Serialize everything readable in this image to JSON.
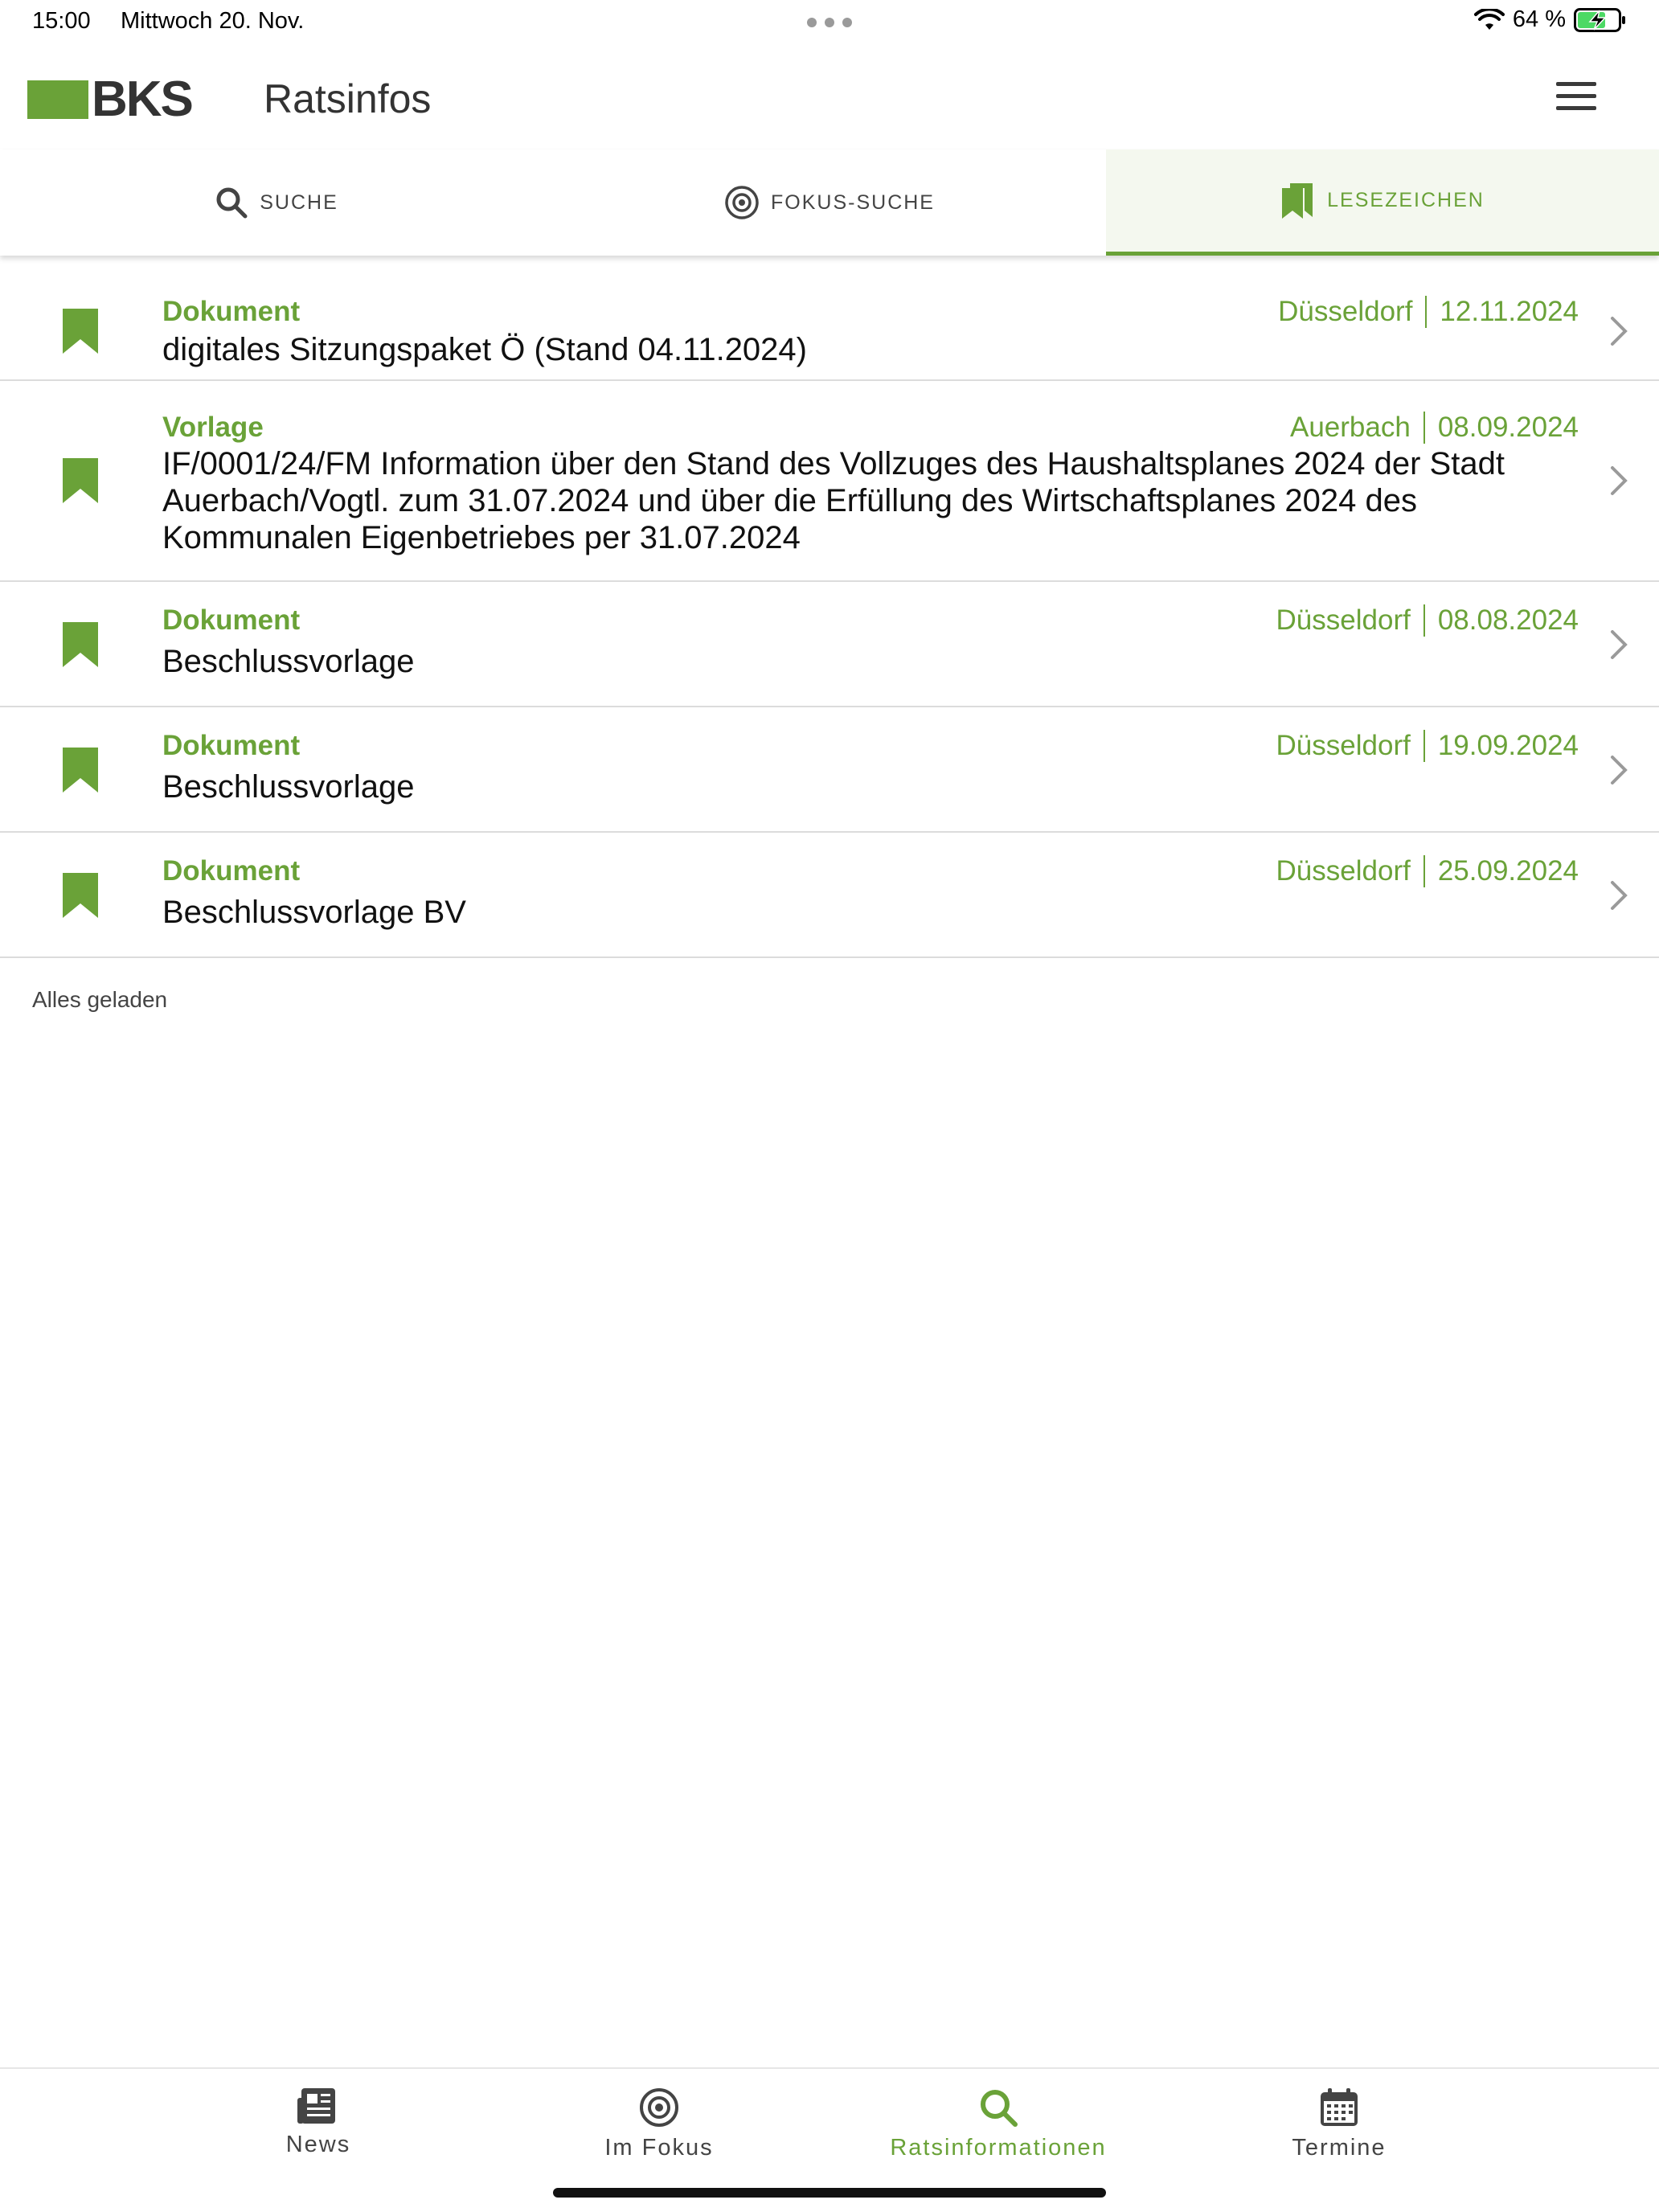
{
  "status": {
    "time": "15:00",
    "date": "Mittwoch 20. Nov.",
    "battery": "64 %"
  },
  "header": {
    "logo_text": "BKS",
    "title": "Ratsinfos"
  },
  "tabs": [
    {
      "label": "SUCHE",
      "icon": "search-icon"
    },
    {
      "label": "FOKUS-SUCHE",
      "icon": "target-icon"
    },
    {
      "label": "LESEZEICHEN",
      "icon": "bookmark-icon",
      "active": true
    }
  ],
  "bookmarks": [
    {
      "type": "Dokument",
      "place": "Düsseldorf",
      "date": "12.11.2024",
      "title": "digitales Sitzungspaket Ö (Stand 04.11.2024)"
    },
    {
      "type": "Vorlage",
      "place": "Auerbach",
      "date": "08.09.2024",
      "title": "IF/0001/24/FM Information über den Stand des Vollzuges des Haushaltsplanes 2024 der Stadt Auerbach/Vogtl. zum 31.07.2024 und über die Erfüllung des Wirtschaftsplanes 2024 des Kommunalen Eigenbetriebes per 31.07.2024"
    },
    {
      "type": "Dokument",
      "place": "Düsseldorf",
      "date": "08.08.2024",
      "title": "Beschlussvorlage"
    },
    {
      "type": "Dokument",
      "place": "Düsseldorf",
      "date": "19.09.2024",
      "title": "Beschlussvorlage"
    },
    {
      "type": "Dokument",
      "place": "Düsseldorf",
      "date": "25.09.2024",
      "title": "Beschlussvorlage BV"
    }
  ],
  "list_footer": "Alles geladen",
  "bottom_nav": [
    {
      "label": "News",
      "icon": "newspaper-icon"
    },
    {
      "label": "Im Fokus",
      "icon": "target-icon"
    },
    {
      "label": "Ratsinformationen",
      "icon": "search-icon",
      "active": true
    },
    {
      "label": "Termine",
      "icon": "calendar-icon"
    }
  ],
  "colors": {
    "accent": "#6aa238",
    "text": "#111111",
    "divider": "#dcdcdc"
  }
}
